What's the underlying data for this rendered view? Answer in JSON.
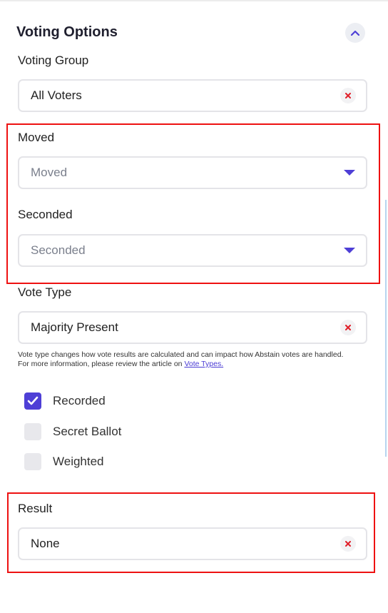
{
  "section": {
    "title": "Voting Options"
  },
  "voting_group": {
    "label": "Voting Group",
    "value": "All Voters"
  },
  "moved": {
    "label": "Moved",
    "placeholder": "Moved"
  },
  "seconded": {
    "label": "Seconded",
    "placeholder": "Seconded"
  },
  "vote_type": {
    "label": "Vote Type",
    "value": "Majority Present",
    "hint_text": "Vote type changes how vote results are calculated and can impact how Abstain votes are handled. For more information, please review the article on ",
    "hint_link": "Vote Types."
  },
  "checkboxes": [
    {
      "label": "Recorded",
      "checked": true
    },
    {
      "label": "Secret Ballot",
      "checked": false
    },
    {
      "label": "Weighted",
      "checked": false
    }
  ],
  "result": {
    "label": "Result",
    "value": "None"
  },
  "colors": {
    "accent": "#4e3fd6",
    "clear_x": "#e0202a",
    "highlight": "#ee1111"
  }
}
